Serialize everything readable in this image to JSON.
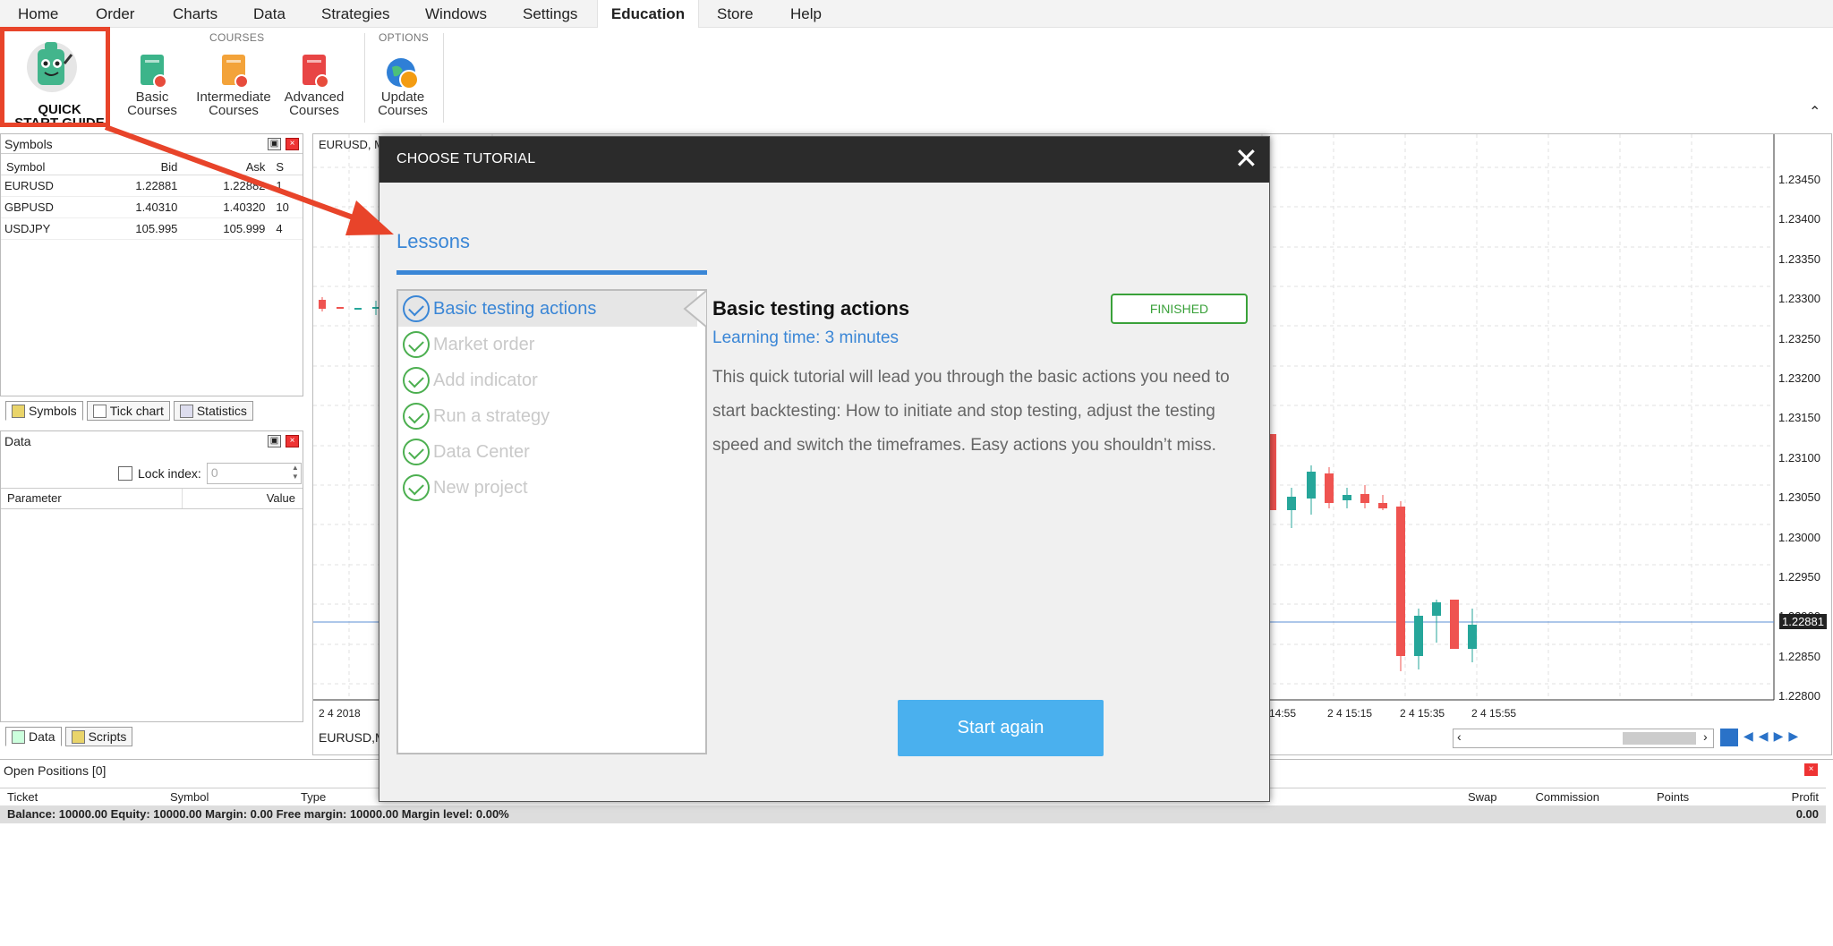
{
  "menu": {
    "items": [
      "Home",
      "Order",
      "Charts",
      "Data",
      "Strategies",
      "Windows",
      "Settings",
      "Education",
      "Store",
      "Help"
    ],
    "active": "Education"
  },
  "ribbon": {
    "quick_start": {
      "line1": "QUICK",
      "line2": "START GUIDE"
    },
    "courses_caption": "COURSES",
    "options_caption": "OPTIONS",
    "basic": {
      "line1": "Basic",
      "line2": "Courses"
    },
    "intermediate": {
      "line1": "Intermediate",
      "line2": "Courses"
    },
    "advanced": {
      "line1": "Advanced",
      "line2": "Courses"
    },
    "update": {
      "line1": "Update",
      "line2": "Courses"
    }
  },
  "symbols_panel": {
    "title": "Symbols",
    "columns": [
      "Symbol",
      "Bid",
      "Ask",
      "S"
    ],
    "rows": [
      [
        "EURUSD",
        "1.22881",
        "1.22882",
        "1"
      ],
      [
        "GBPUSD",
        "1.40310",
        "1.40320",
        "10"
      ],
      [
        "USDJPY",
        "105.995",
        "105.999",
        "4"
      ]
    ],
    "tabs": [
      "Symbols",
      "Tick chart",
      "Statistics"
    ]
  },
  "data_panel": {
    "title": "Data",
    "lock_index_label": "Lock index:",
    "lock_index_value": "0",
    "columns": [
      "Parameter",
      "Value"
    ],
    "tabs": [
      "Data",
      "Scripts"
    ]
  },
  "chart": {
    "title": "EURUSD, M",
    "bottom_label": "EURUSD,M",
    "price_labels": [
      "1.23450",
      "1.23400",
      "1.23350",
      "1.23300",
      "1.23250",
      "1.23200",
      "1.23150",
      "1.23100",
      "1.23050",
      "1.23000",
      "1.22950",
      "1.22900",
      "1.22850",
      "1.22800"
    ],
    "current_price": "1.22881",
    "time_labels": [
      "2 4 2018",
      "14:55",
      "2 4 15:15",
      "2 4 15:35",
      "2 4 15:55"
    ]
  },
  "positions": {
    "title": "Open Positions [0]",
    "columns": [
      "Ticket",
      "Symbol",
      "Type",
      "",
      "",
      "",
      "",
      "",
      "",
      "",
      "Swap",
      "Commission",
      "Points",
      "Profit"
    ],
    "summary": "Balance: 10000.00 Equity: 10000.00 Margin: 0.00 Free margin: 10000.00 Margin level: 0.00%",
    "summary_profit": "0.00"
  },
  "modal": {
    "title": "CHOOSE TUTORIAL",
    "section": "Lessons",
    "lessons": [
      "Basic testing actions",
      "Market order",
      "Add indicator",
      "Run a strategy",
      "Data Center",
      "New project"
    ],
    "active_lesson": "Basic testing actions",
    "detail_title": "Basic testing actions",
    "status": "FINISHED",
    "learning_time": "Learning time: 3 minutes",
    "description": "This quick tutorial will lead you through the basic actions you need to start backtesting: How to initiate and stop testing, adjust the testing speed and switch the timeframes. Easy actions you shouldn’t miss.",
    "button": "Start again"
  },
  "colors": {
    "accent": "#3a86d6",
    "button": "#4ab0ee",
    "finished": "#3aa13a",
    "annotation": "#e8442a",
    "bull": "#26a69a",
    "bear": "#ef5350"
  }
}
